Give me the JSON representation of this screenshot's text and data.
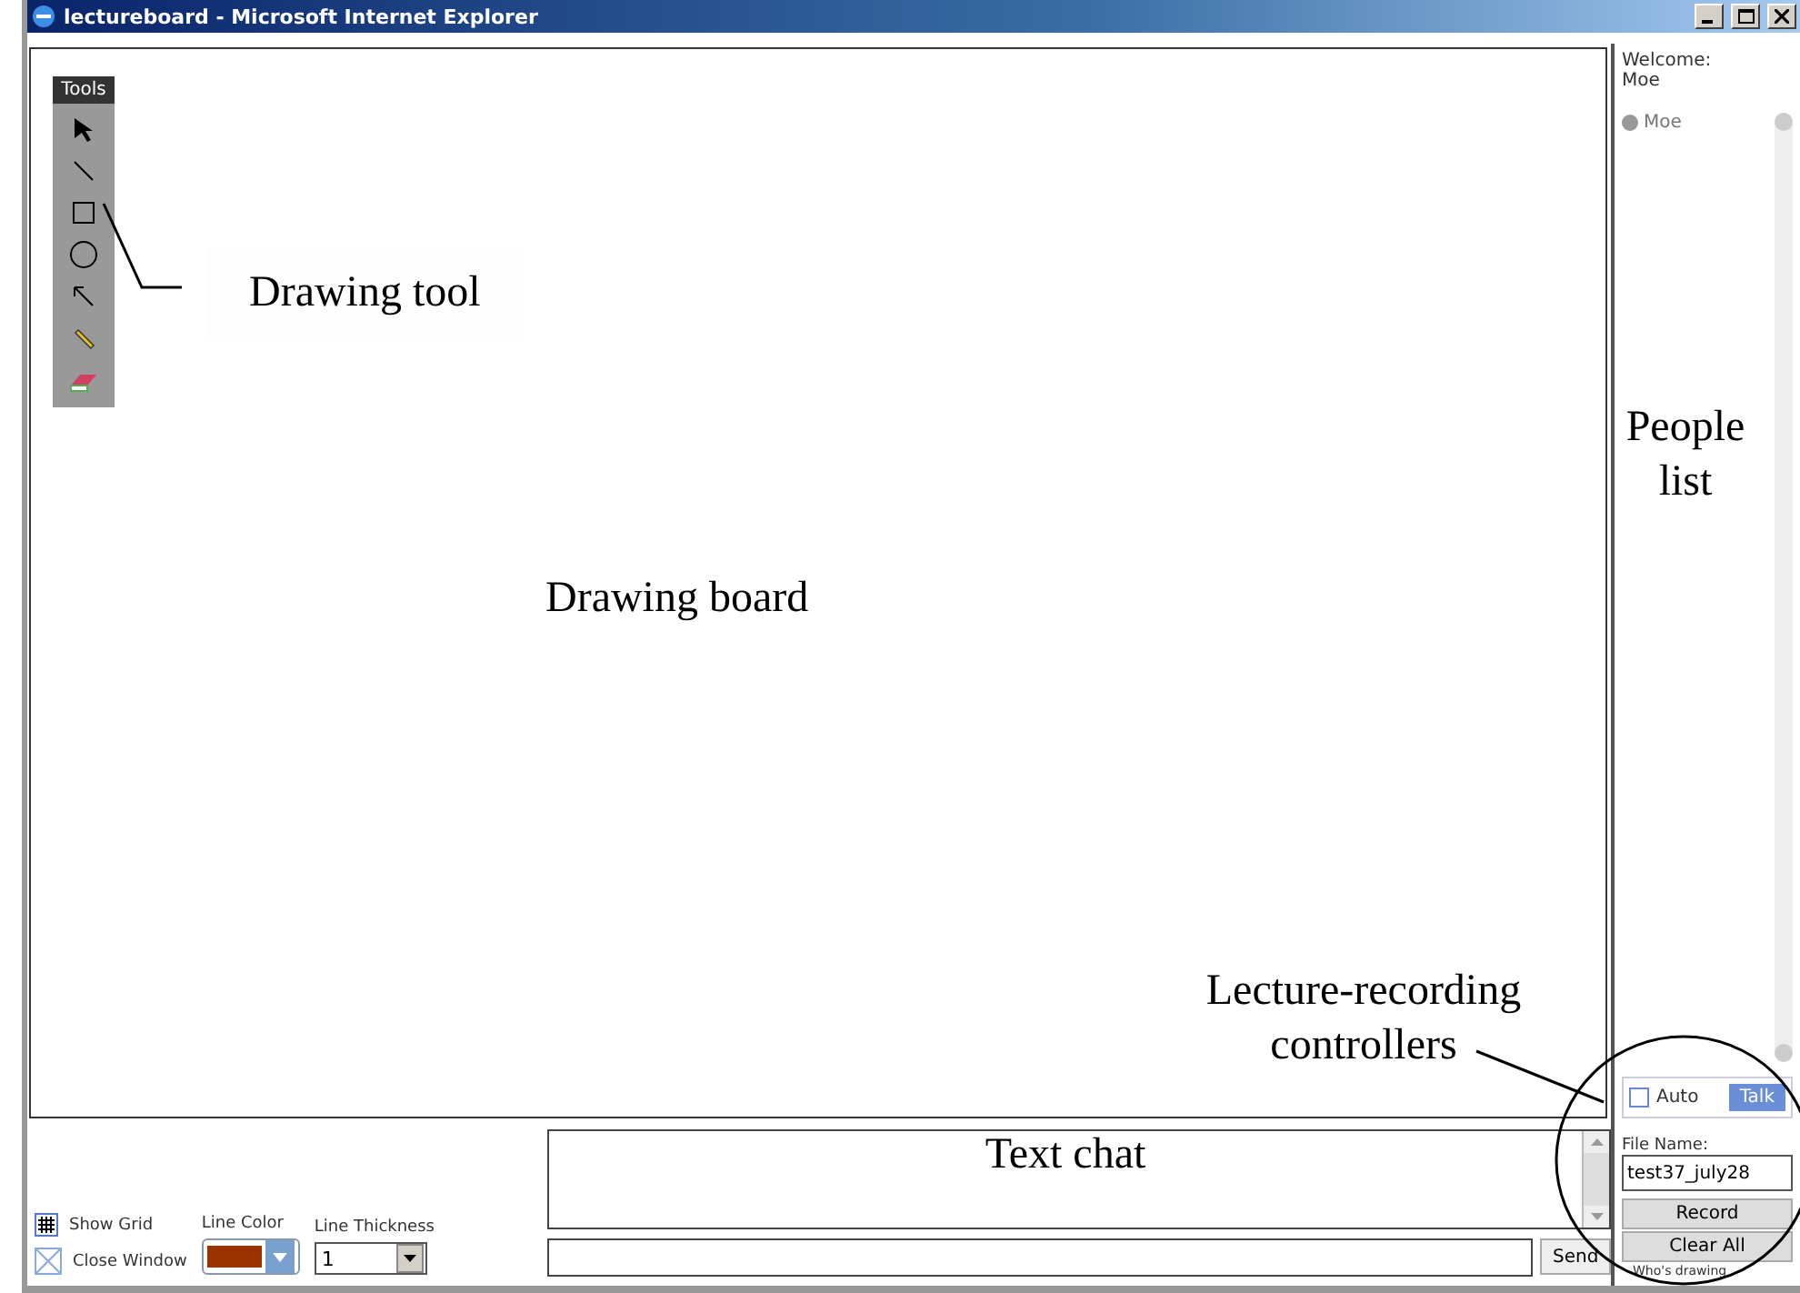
{
  "window": {
    "title": "lectureboard - Microsoft Internet Explorer"
  },
  "tools_palette": {
    "title": "Tools",
    "tools": [
      {
        "kind": "select"
      },
      {
        "kind": "line"
      },
      {
        "kind": "rectangle"
      },
      {
        "kind": "ellipse"
      },
      {
        "kind": "arrow"
      },
      {
        "kind": "pencil"
      },
      {
        "kind": "eraser"
      }
    ]
  },
  "people_panel": {
    "welcome_label": "Welcome:",
    "user_name": "Moe",
    "people": [
      {
        "name": "Moe"
      }
    ]
  },
  "recording": {
    "auto_label": "Auto",
    "auto_checked": false,
    "talk_label": "Talk",
    "file_name_label": "File Name:",
    "file_name": "test37_july28",
    "buttons": [
      "Record",
      "Clear All"
    ],
    "status": "Who's drawing"
  },
  "bottom_bar": {
    "show_grid": "Show Grid",
    "close_window": "Close Window",
    "line_color_label": "Line Color",
    "line_color_swatch": {
      "color": "#993300"
    },
    "line_thickness_label": "Line Thickness",
    "line_thickness": "1"
  },
  "chat": {
    "send_label": "Send"
  },
  "annotations": {
    "drawing_tool": "Drawing tool",
    "people_list": "People list",
    "drawing_board": "Drawing board",
    "text_chat": "Text chat",
    "recording_controllers": "Lecture-recording controllers"
  }
}
